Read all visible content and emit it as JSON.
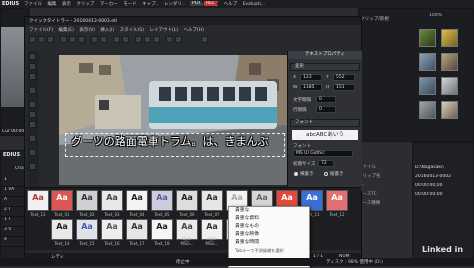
{
  "titlebar": {
    "app": "EDIUS",
    "menu": [
      "ファイル",
      "編集",
      "表示",
      "クリップ",
      "マーカー",
      "モード",
      "キャプ..",
      "レンダリ..",
      "ツール",
      "設定",
      "ヘルプ",
      "Evaluati..."
    ],
    "plr": "PLR",
    "rec": "REC"
  },
  "titler": {
    "title": "クイックタイトラー - 20160413-0003.etl",
    "menu": [
      "ファイル(F)",
      "編集(E)",
      "表示(V)",
      "挿入(I)",
      "スタイル(S)",
      "レイアウト(L)",
      "ヘルプ(H)"
    ],
    "subtitle": "グーツの路面電車トラム。は、きまんぶ",
    "props_header": "テキストプロパティ",
    "transform": {
      "section": "変形",
      "x_label": "X",
      "x_value": "123",
      "y_label": "Y",
      "y_value": "552",
      "w_label": "W",
      "w_value": "1185",
      "h_label": "H",
      "h_value": "151",
      "char_spacing_label": "文字間隔",
      "char_spacing_value": "0",
      "line_spacing_label": "行間隔",
      "line_spacing_value": "0"
    },
    "font": {
      "section": "フォント",
      "preview": "abcABCあいう",
      "family_label": "フォント",
      "family_value": "MS UI Gothic",
      "size_label": "初期サイズ",
      "size_value": "72",
      "horizontal": "横書き",
      "vertical": "縦書き"
    },
    "status_left": "レディ",
    "status_page": "1 / 1",
    "status_num": "NUM"
  },
  "styles": [
    {
      "label": "Text_01"
    },
    {
      "label": "Text_02"
    },
    {
      "label": "Text_03"
    },
    {
      "label": "Text_04"
    },
    {
      "label": "Text_05"
    },
    {
      "label": "Text_06"
    },
    {
      "label": "Text_07"
    },
    {
      "label": "Text_08"
    },
    {
      "label": "Text_09"
    },
    {
      "label": "Text_10"
    },
    {
      "label": "Text_11"
    },
    {
      "label": "Text_12"
    },
    {
      "label": "Text_13"
    },
    {
      "label": "Text_14"
    },
    {
      "label": "Text_15"
    },
    {
      "label": "Text_16"
    },
    {
      "label": "Text_17"
    },
    {
      "label": "Text_18"
    },
    {
      "label": "style-MSG..."
    },
    {
      "label": "style-MSG..."
    },
    {
      "label": "style-MSG..."
    },
    {
      "label": "style-MSG..."
    },
    {
      "label": "style-MSG..."
    },
    {
      "label": "style-MSG..."
    },
    {
      "label": "style-MSG..."
    },
    {
      "label": "style-MSG..."
    }
  ],
  "style_aa": "Aa",
  "context_menu": [
    "貴重な",
    "貴重な資料",
    "貴重なもの",
    "貴重な映像",
    "貴重な時間",
    "Tabキーで予測候補を選択"
  ],
  "bin": {
    "header": "GV Browser/すべてのクリップ/新規",
    "count": "100%",
    "folder": "FOLDER",
    "count2": "10 / 118"
  },
  "info": {
    "items": [
      "ファイル",
      "クリップ名",
      "TC",
      "ソースTC",
      "ソース種類"
    ],
    "values": [
      "D:\\Nagasaki\\",
      "20160413-0002",
      "00:00:00;00",
      "00:00:00;00",
      ""
    ]
  },
  "left": {
    "cur_label": "Cur 00:00:08",
    "edius2": "EDIUS",
    "chapter": "Chapter",
    "tracks": [
      "1",
      "1 VA",
      "A",
      "2 T",
      "1 T",
      "3 V",
      "4"
    ]
  },
  "bottom": {
    "status_center": "停止中",
    "status_right": "ディスク : 98% 使用中 (D:)"
  },
  "watermark": "Linked in",
  "colors": {
    "accent": "#d23a3a",
    "panel": "#232529",
    "canvas": "#6e7479"
  }
}
